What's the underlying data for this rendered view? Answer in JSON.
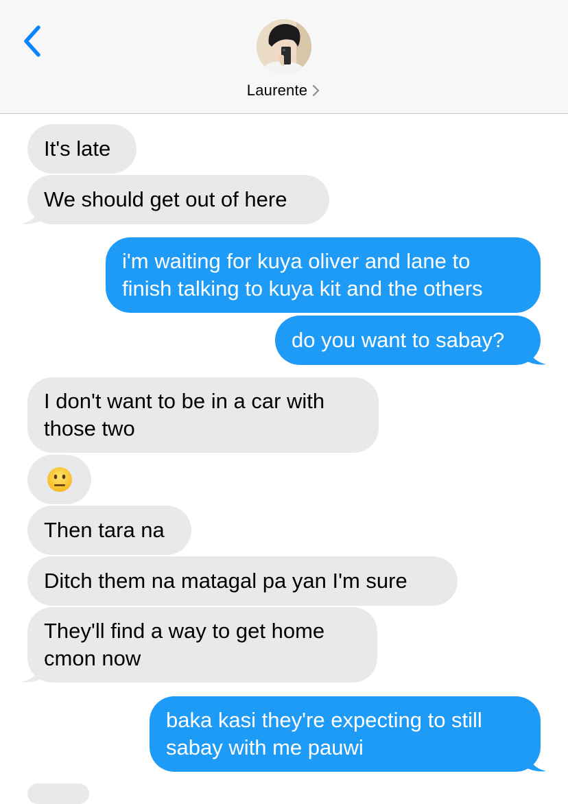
{
  "header": {
    "back_icon": "chevron-left-icon",
    "contact_name": "Laurente",
    "name_chevron_icon": "chevron-right-icon",
    "avatar": "contact-avatar-photo"
  },
  "colors": {
    "incoming_bubble": "#e9e9eb",
    "outgoing_bubble": "#1d9bf6",
    "accent": "#0a84ff",
    "header_bg": "#f7f7f7"
  },
  "messages": [
    {
      "from": "them",
      "lines": [
        "It's late"
      ]
    },
    {
      "from": "them",
      "lines": [
        "We should get out of here"
      ]
    },
    {
      "from": "me",
      "lines": [
        "i'm waiting for kuya oliver and lane to",
        "finish talking to kuya kit and the others"
      ]
    },
    {
      "from": "me",
      "lines": [
        "do you want to sabay?"
      ]
    },
    {
      "from": "them",
      "lines": [
        "I don't want to be in a car with",
        "those two"
      ]
    },
    {
      "from": "them",
      "emoji": "neutral-face-emoji"
    },
    {
      "from": "them",
      "lines": [
        "Then tara na"
      ]
    },
    {
      "from": "them",
      "lines": [
        "Ditch them na matagal pa yan I'm sure"
      ]
    },
    {
      "from": "them",
      "lines": [
        "They'll find a way to get home",
        "cmon now"
      ]
    },
    {
      "from": "me",
      "lines": [
        "baka kasi they're expecting to still",
        "sabay with me pauwi"
      ]
    }
  ]
}
